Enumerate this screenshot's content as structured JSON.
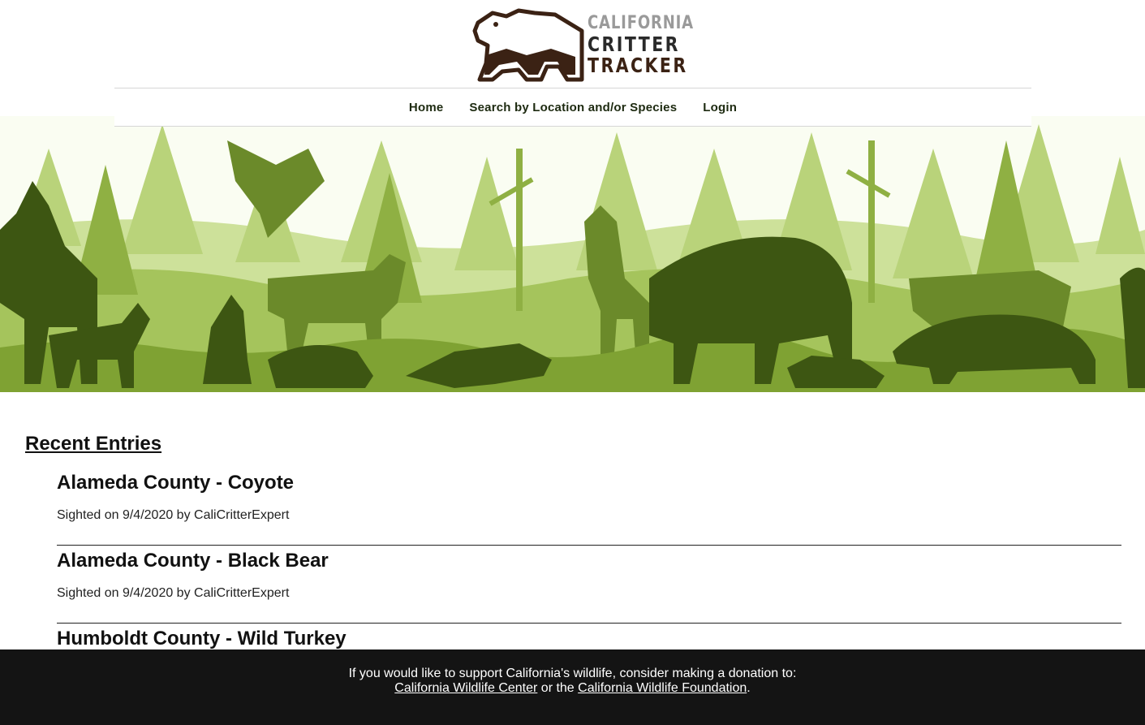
{
  "brand": {
    "line1": "CALIFORNIA",
    "line2": "CRITTER",
    "line3": "TRACKER"
  },
  "nav": {
    "items": [
      {
        "label": "Home"
      },
      {
        "label": "Search by Location and/or Species"
      },
      {
        "label": "Login"
      }
    ]
  },
  "banner": {
    "icon": "wildlife-forest-silhouette-banner",
    "colors": {
      "light": "#b9d37a",
      "mid": "#8fb043",
      "dark": "#5d7c1f",
      "darkest": "#3d5612"
    }
  },
  "main": {
    "heading": "Recent Entries",
    "entries": [
      {
        "title": "Alameda County - Coyote",
        "meta": "Sighted on 9/4/2020 by CaliCritterExpert"
      },
      {
        "title": "Alameda County - Black Bear",
        "meta": "Sighted on 9/4/2020 by CaliCritterExpert"
      },
      {
        "title": "Humboldt County - Wild Turkey",
        "meta": ""
      }
    ]
  },
  "footer": {
    "text": "If you would like to support California's wildlife, consider making a donation to:",
    "link1": "California Wildlife Center",
    "connector": " or the ",
    "link2": "California Wildlife Foundation",
    "end": "."
  }
}
